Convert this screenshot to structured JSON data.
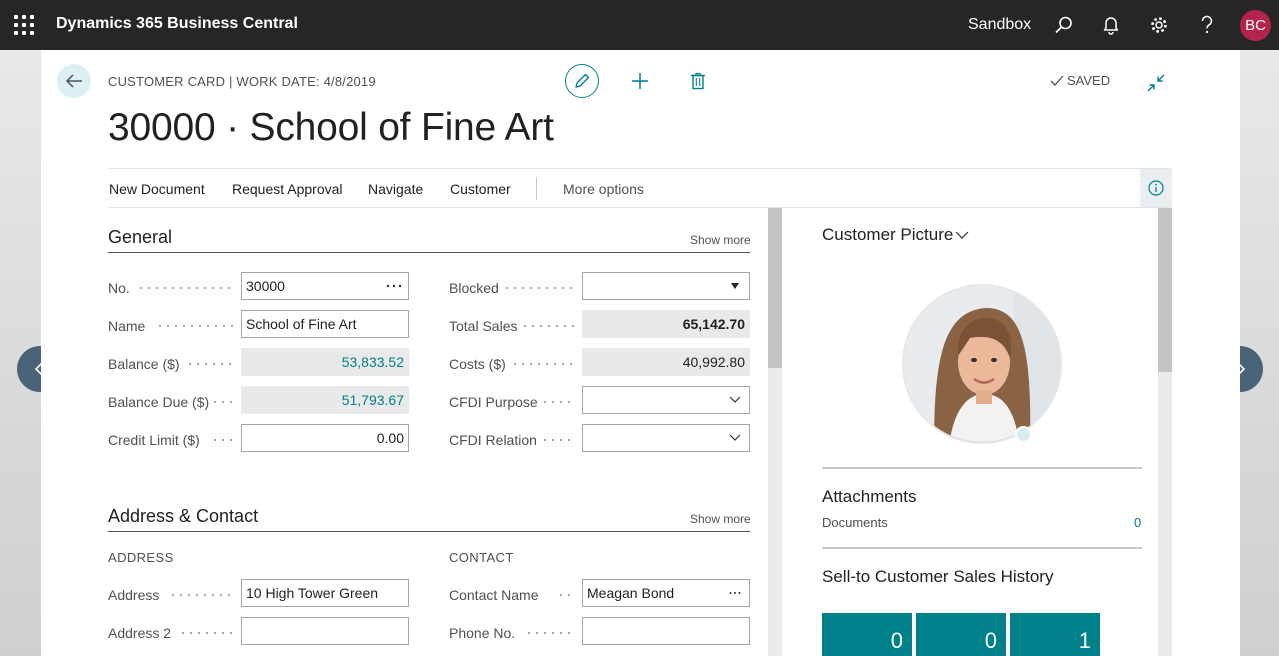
{
  "topbar": {
    "app_title": "Dynamics 365 Business Central",
    "environment": "Sandbox",
    "avatar_initials": "BC"
  },
  "header": {
    "caption": "CUSTOMER CARD | WORK DATE: 4/8/2019",
    "saved_label": "SAVED",
    "title": "30000 · School of Fine Art"
  },
  "actionbar": {
    "items": [
      "New Document",
      "Request Approval",
      "Navigate",
      "Customer"
    ],
    "more_options": "More options"
  },
  "general": {
    "title": "General",
    "show_more": "Show more",
    "left": [
      {
        "label": "No.",
        "value": "30000"
      },
      {
        "label": "Name",
        "value": "School of Fine Art"
      },
      {
        "label": "Balance ($)",
        "value": "53,833.52"
      },
      {
        "label": "Balance Due ($)",
        "value": "51,793.67"
      },
      {
        "label": "Credit Limit ($)",
        "value": "0.00"
      }
    ],
    "right": [
      {
        "label": "Blocked",
        "value": ""
      },
      {
        "label": "Total Sales",
        "value": "65,142.70"
      },
      {
        "label": "Costs ($)",
        "value": "40,992.80"
      },
      {
        "label": "CFDI Purpose",
        "value": ""
      },
      {
        "label": "CFDI Relation",
        "value": ""
      }
    ]
  },
  "address_contact": {
    "title": "Address & Contact",
    "show_more": "Show more",
    "address_group": "ADDRESS",
    "contact_group": "CONTACT",
    "address": {
      "label": "Address",
      "value": "10 High Tower Green"
    },
    "address2": {
      "label": "Address 2",
      "value": ""
    },
    "contact_name": {
      "label": "Contact Name",
      "value": "Meagan Bond"
    },
    "phone": {
      "label": "Phone No.",
      "value": ""
    }
  },
  "factbox": {
    "picture_title": "Customer Picture",
    "attachments_title": "Attachments",
    "documents_label": "Documents",
    "documents_count": "0",
    "history_title": "Sell-to Customer Sales History",
    "cues": [
      "0",
      "0",
      "1"
    ]
  },
  "colors": {
    "accent": "#00818a",
    "topbar": "#262626",
    "avatar": "#b4234a",
    "nav_arrow": "#4a6378"
  },
  "icons": [
    "waffle-icon",
    "search-icon",
    "bell-icon",
    "gear-icon",
    "help-icon",
    "back-arrow-icon",
    "pencil-icon",
    "plus-icon",
    "trash-icon",
    "check-icon",
    "collapse-icon",
    "info-icon",
    "ellipsis-icon",
    "dropdown-arrow-icon",
    "chevron-down-icon",
    "chevron-left-icon",
    "chevron-right-icon"
  ]
}
